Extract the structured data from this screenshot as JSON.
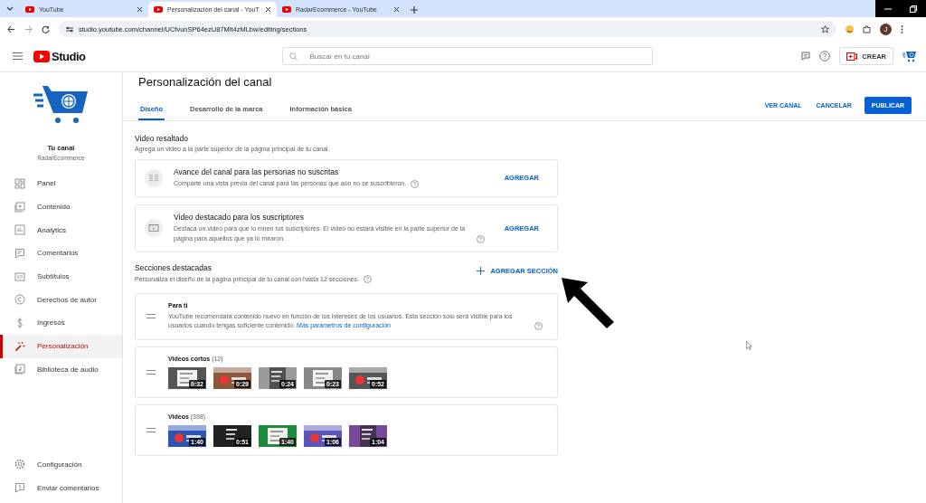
{
  "browser": {
    "tabs": [
      {
        "title": "YouTube",
        "selected": false
      },
      {
        "title": "Personalización del canal - YouT",
        "selected": true
      },
      {
        "title": "RadarEcommerce - YouTube",
        "selected": false
      }
    ],
    "address": "studio.youtube.com/channel/UCfvunSP64ezU87Mlt4zMLbw/editing/sections",
    "profile_initial": "J"
  },
  "header": {
    "logo": "Studio",
    "search_placeholder": "Buscar en tu canal",
    "create_label": "CREAR"
  },
  "sidebar": {
    "channel_title": "Tu canal",
    "channel_name": "RadarEcommerce",
    "items": [
      {
        "label": "Panel",
        "selected": false
      },
      {
        "label": "Contenido",
        "selected": false
      },
      {
        "label": "Analytics",
        "selected": false
      },
      {
        "label": "Comentarios",
        "selected": false
      },
      {
        "label": "Subtítulos",
        "selected": false
      },
      {
        "label": "Derechos de autor",
        "selected": false
      },
      {
        "label": "Ingresos",
        "selected": false
      },
      {
        "label": "Personalización",
        "selected": true
      },
      {
        "label": "Biblioteca de audio",
        "selected": false
      }
    ],
    "footer_items": [
      {
        "label": "Configuración"
      },
      {
        "label": "Enviar comentarios"
      }
    ]
  },
  "page": {
    "title": "Personalización del canal",
    "tabs": [
      {
        "label": "Diseño",
        "selected": true
      },
      {
        "label": "Desarrollo de la marca",
        "selected": false
      },
      {
        "label": "Información básica",
        "selected": false
      }
    ],
    "actions": [
      {
        "label": "VER CANAL",
        "kind": "text"
      },
      {
        "label": "CANCELAR",
        "kind": "text"
      },
      {
        "label": "PUBLICAR",
        "kind": "primary"
      }
    ]
  },
  "featured_video": {
    "title": "Video resaltado",
    "description": "Agrega un video a la parte superior de la página principal de tu canal.",
    "cards": [
      {
        "title": "Avance del canal para las personas no suscritas",
        "description": "Comparte una vista previa del canal para las personas que aún no se suscribieron.",
        "action": "AGREGAR"
      },
      {
        "title": "Video destacado para los suscriptores",
        "description": "Destaca un video para que lo miren tus suscriptores. El video no estará visible en la parte superior de la página para aquellos que ya lo miraron.",
        "action": "AGREGAR"
      }
    ]
  },
  "sections": {
    "title": "Secciones destacadas",
    "description": "Personaliza el diseño de la página principal de tu canal con hasta 12 secciones.",
    "add_label": "AGREGAR SECCIÓN",
    "items": [
      {
        "kind": "text",
        "title": "Para ti",
        "description": "YouTube recomendará contenido nuevo en función de los intereses de los usuarios. Esta sección solo será visible para los usuarios cuando tengas suficiente contenido.",
        "link": "Más parámetros de configuración"
      },
      {
        "kind": "shelf",
        "title": "Videos cortos",
        "count": "(12)",
        "thumbnails": [
          {
            "duration": "0:32",
            "color": "#555555"
          },
          {
            "duration": "0:29",
            "color": "#8a5a3a"
          },
          {
            "duration": "0:24",
            "color": "#9a9a9a"
          },
          {
            "duration": "0:23",
            "color": "#888888"
          },
          {
            "duration": "0:52",
            "color": "#555555"
          }
        ]
      },
      {
        "kind": "shelf",
        "title": "Videos",
        "count": "(398)",
        "thumbnails": [
          {
            "duration": "1:40",
            "color": "#2b55b0"
          },
          {
            "duration": "0:51",
            "color": "#222222"
          },
          {
            "duration": "1:40",
            "color": "#1e8a3c"
          },
          {
            "duration": "1:06",
            "color": "#5a56b8"
          },
          {
            "duration": "1:04",
            "color": "#7a4a9a"
          }
        ]
      }
    ]
  }
}
